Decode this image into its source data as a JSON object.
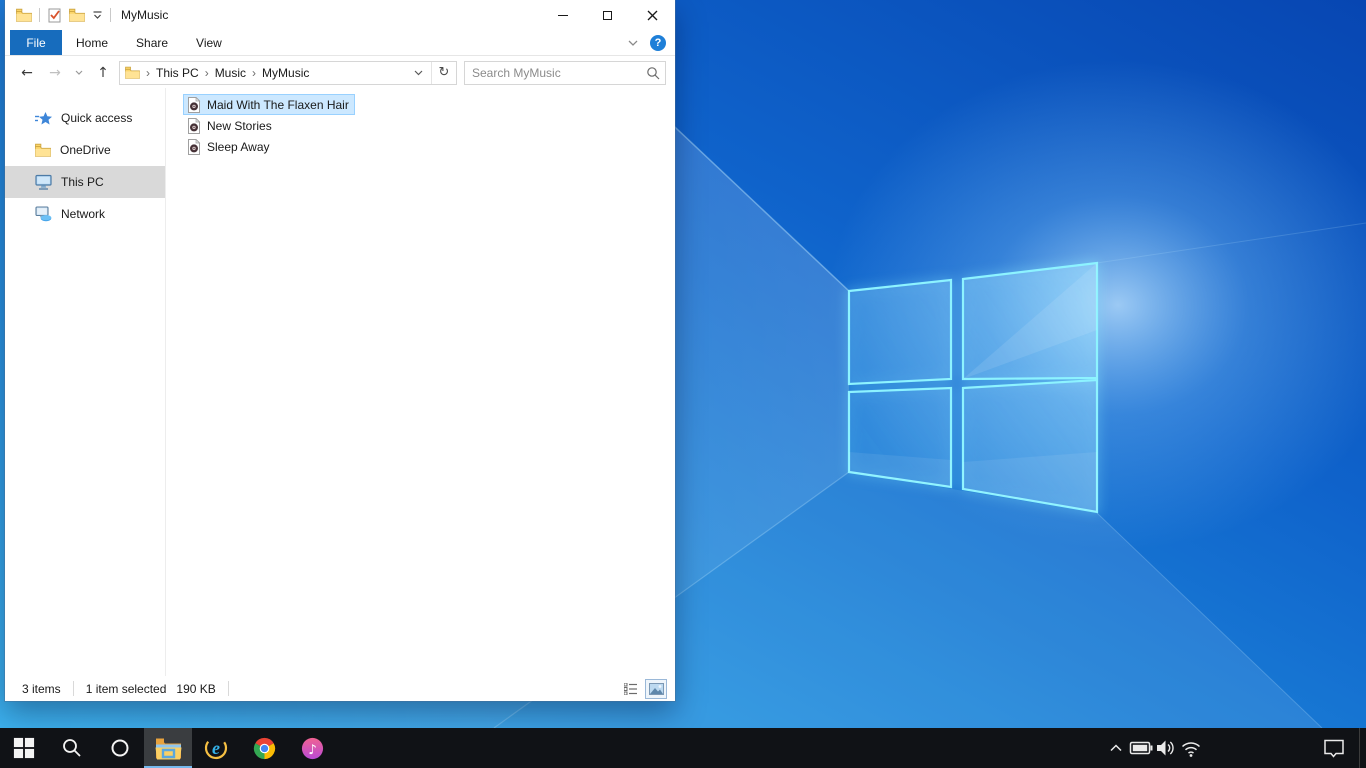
{
  "colors": {
    "accent_blue": "#176cbd",
    "selection_bg": "#cce8ff",
    "selection_border": "#99d1ff",
    "sidebar_selected_bg": "#d9d9d9",
    "taskbar_bg": "#101216",
    "taskbar_active_underline": "#76b9ed",
    "wallpaper_dark": "#0746b2",
    "wallpaper_light": "#36aeec",
    "logo_edge": "#8df3ff"
  },
  "window": {
    "title": "MyMusic",
    "tabs": [
      {
        "label": "File",
        "active": true
      },
      {
        "label": "Home",
        "active": false
      },
      {
        "label": "Share",
        "active": false
      },
      {
        "label": "View",
        "active": false
      }
    ],
    "help_glyph": "?",
    "nav_icons": {
      "back": "←",
      "forward": "→",
      "up": "↑",
      "refresh": "↻"
    },
    "breadcrumb": {
      "separator": "›",
      "segments": [
        "This PC",
        "Music",
        "MyMusic"
      ]
    },
    "search": {
      "placeholder": "Search MyMusic"
    },
    "sidebar": [
      {
        "label": "Quick access",
        "icon": "quick-access-star-icon",
        "selected": false
      },
      {
        "label": "OneDrive",
        "icon": "folder-icon",
        "selected": false
      },
      {
        "label": "This PC",
        "icon": "this-pc-icon",
        "selected": true
      },
      {
        "label": "Network",
        "icon": "network-icon",
        "selected": false
      }
    ],
    "files": [
      {
        "name": "Maid With The Flaxen Hair",
        "icon": "audio-file-icon",
        "selected": true
      },
      {
        "name": "New Stories",
        "icon": "audio-file-icon",
        "selected": false
      },
      {
        "name": "Sleep Away",
        "icon": "audio-file-icon",
        "selected": false
      }
    ],
    "status": {
      "count": "3 items",
      "selected": "1 item selected",
      "size": "190 KB"
    }
  },
  "taskbar": {
    "items": [
      "start",
      "search",
      "cortana",
      "file-explorer",
      "internet-explorer",
      "chrome",
      "itunes"
    ],
    "active_item": "file-explorer",
    "tray": [
      "hidden-icons-chevron",
      "battery",
      "volume",
      "network-wifi",
      "action-center",
      "show-desktop"
    ]
  }
}
